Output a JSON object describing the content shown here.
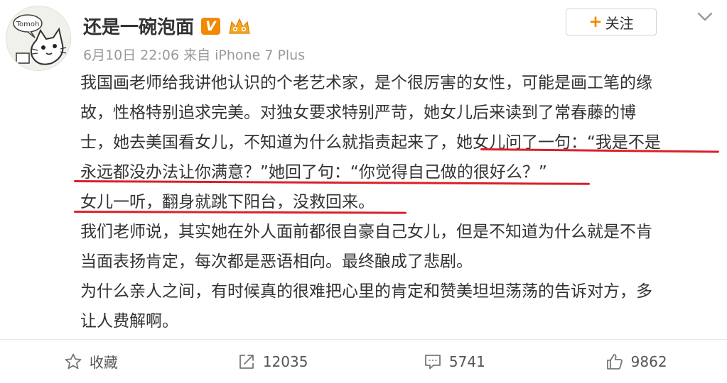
{
  "header": {
    "username": "还是一碗泡面",
    "vip_badge": "V",
    "meta": "6月10日 22:06 来自 iPhone 7 Plus",
    "follow_label": "关注",
    "follow_plus": "+",
    "avatar_text": "Tomoh"
  },
  "post": {
    "lines": [
      "我国画老师给我讲他认识的个老艺术家，是个很厉害的女性，可能是画工笔的缘",
      "故，性格特别追求完美。对独女要求特别严苛，她女儿后来读到了常春藤的博",
      "士，她去美国看女儿，不知道为什么就指责起来了，她女儿问了一句：“我是不是",
      "永远都没办法让你满意？”她回了句：“你觉得自己做的很好么？”",
      "女儿一听，翻身就跳下阳台，没救回来。",
      "我们老师说，其实她在外人面前都很自豪自己女儿，但是不知道为什么就是不肯",
      "当面表扬肯定，每次都是恶语相向。最终酿成了悲剧。",
      "为什么亲人之间，有时候真的很难把心里的肯定和赞美坦坦荡荡的告诉对方，多",
      "让人费解啊。"
    ]
  },
  "actions": {
    "favorite_label": "收藏",
    "repost_count": "12035",
    "comment_count": "5741",
    "like_count": "9862"
  },
  "colors": {
    "underline": "#d8212a",
    "vip": "#f28900",
    "meta_text": "#999999"
  }
}
